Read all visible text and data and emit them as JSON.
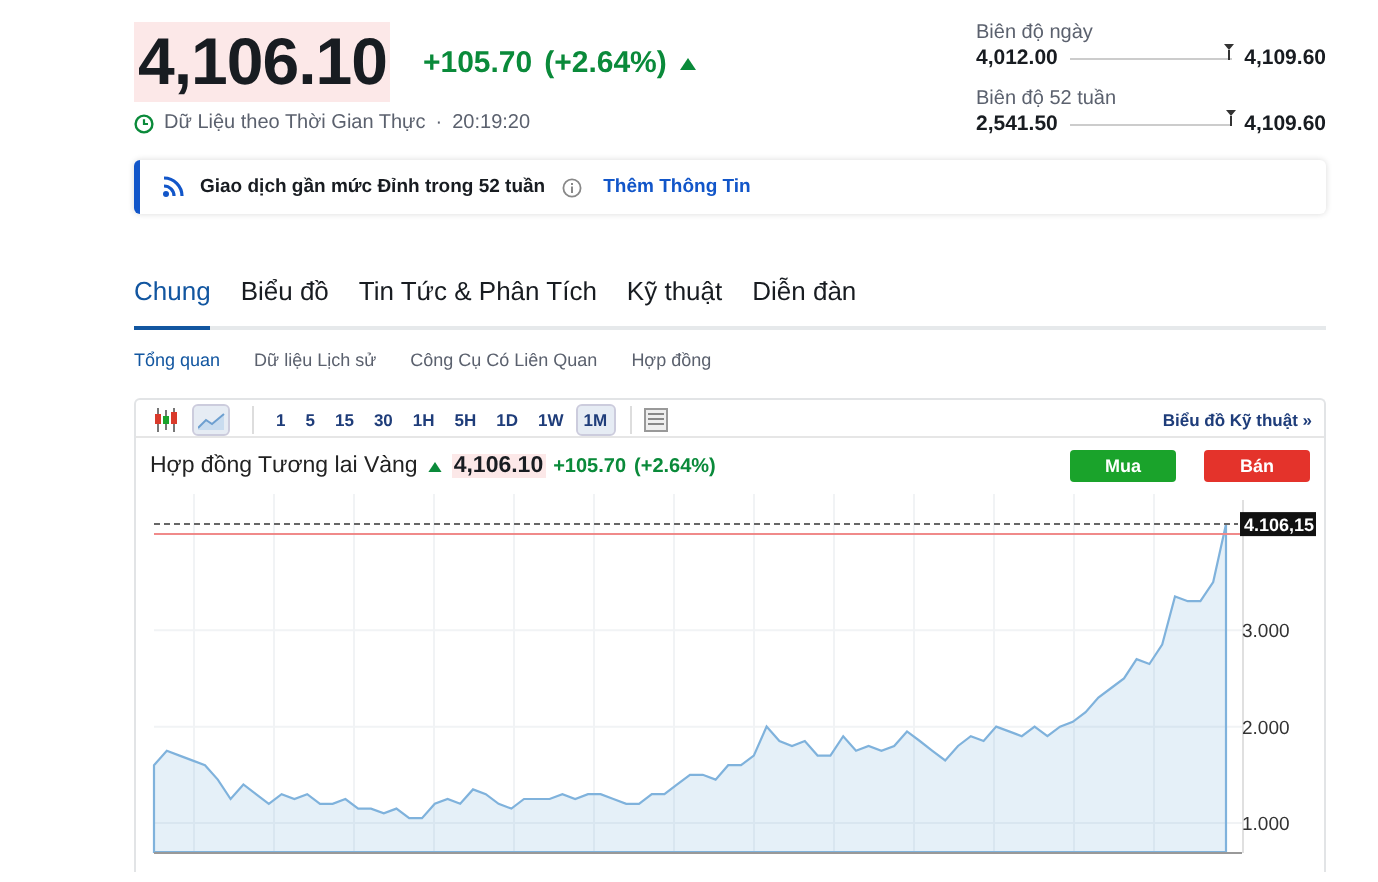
{
  "quote": {
    "price": "4,106.10",
    "change": "+105.70",
    "change_pct": "(+2.64%)",
    "realtime_label": "Dữ Liệu theo Thời Gian Thực",
    "separator": "·",
    "time": "20:19:20"
  },
  "ranges": [
    {
      "label": "Biên độ ngày",
      "low": "4,012.00",
      "high": "4,109.60",
      "level": 0.97
    },
    {
      "label": "Biên độ 52 tuần",
      "low": "2,541.50",
      "high": "4,109.60",
      "level": 0.98
    }
  ],
  "banner": {
    "text": "Giao dịch gần mức Đỉnh trong 52 tuần",
    "link": "Thêm Thông Tin"
  },
  "tabs": [
    {
      "label": "Chung",
      "selected": true
    },
    {
      "label": "Biểu đồ",
      "selected": false
    },
    {
      "label": "Tin Tức & Phân Tích",
      "selected": false
    },
    {
      "label": "Kỹ thuật",
      "selected": false
    },
    {
      "label": "Diễn đàn",
      "selected": false
    }
  ],
  "subtabs": [
    {
      "label": "Tổng quan",
      "selected": true
    },
    {
      "label": "Dữ liệu Lịch sử",
      "selected": false
    },
    {
      "label": "Công Cụ Có Liên Quan",
      "selected": false
    },
    {
      "label": "Hợp đồng",
      "selected": false
    }
  ],
  "chart_widget": {
    "chart_types": [
      {
        "kind": "candles",
        "selected": false
      },
      {
        "kind": "area",
        "selected": true
      }
    ],
    "intervals": [
      {
        "label": "1",
        "selected": false
      },
      {
        "label": "5",
        "selected": false
      },
      {
        "label": "15",
        "selected": false
      },
      {
        "label": "30",
        "selected": false
      },
      {
        "label": "1H",
        "selected": false
      },
      {
        "label": "5H",
        "selected": false
      },
      {
        "label": "1D",
        "selected": false
      },
      {
        "label": "1W",
        "selected": false
      },
      {
        "label": "1M",
        "selected": true
      }
    ],
    "link": "Biểu đồ Kỹ thuật »",
    "instrument": "Hợp đồng Tương lai Vàng",
    "price": "4,106.10",
    "change": "+105.70",
    "change_pct": "(+2.64%)",
    "last_price_label": "4.106,15",
    "buy": "Mua",
    "sell": "Bán",
    "chart_data": {
      "type": "area",
      "grid": true,
      "ylim": [
        0.7,
        4.35
      ],
      "yticks": [
        {
          "value": 1,
          "label": "1.000"
        },
        {
          "value": 2,
          "label": "2.000"
        },
        {
          "value": 3,
          "label": "3.000"
        }
      ],
      "series": [
        {
          "color": "#7fb2dc",
          "values": [
            1.6,
            1.75,
            1.7,
            1.65,
            1.6,
            1.45,
            1.25,
            1.4,
            1.3,
            1.2,
            1.3,
            1.25,
            1.3,
            1.2,
            1.2,
            1.25,
            1.15,
            1.15,
            1.1,
            1.15,
            1.05,
            1.05,
            1.2,
            1.25,
            1.2,
            1.35,
            1.3,
            1.2,
            1.15,
            1.25,
            1.25,
            1.25,
            1.3,
            1.25,
            1.3,
            1.3,
            1.25,
            1.2,
            1.2,
            1.3,
            1.3,
            1.4,
            1.5,
            1.5,
            1.45,
            1.6,
            1.6,
            1.7,
            2,
            1.85,
            1.8,
            1.85,
            1.7,
            1.7,
            1.9,
            1.75,
            1.8,
            1.75,
            1.8,
            1.95,
            1.85,
            1.75,
            1.65,
            1.8,
            1.9,
            1.85,
            2,
            1.95,
            1.9,
            2,
            1.9,
            2,
            2.05,
            2.15,
            2.3,
            2.4,
            2.5,
            2.7,
            2.65,
            2.85,
            3.35,
            3.3,
            3.3,
            3.5,
            4.1
          ]
        }
      ],
      "stacked": false
    }
  }
}
